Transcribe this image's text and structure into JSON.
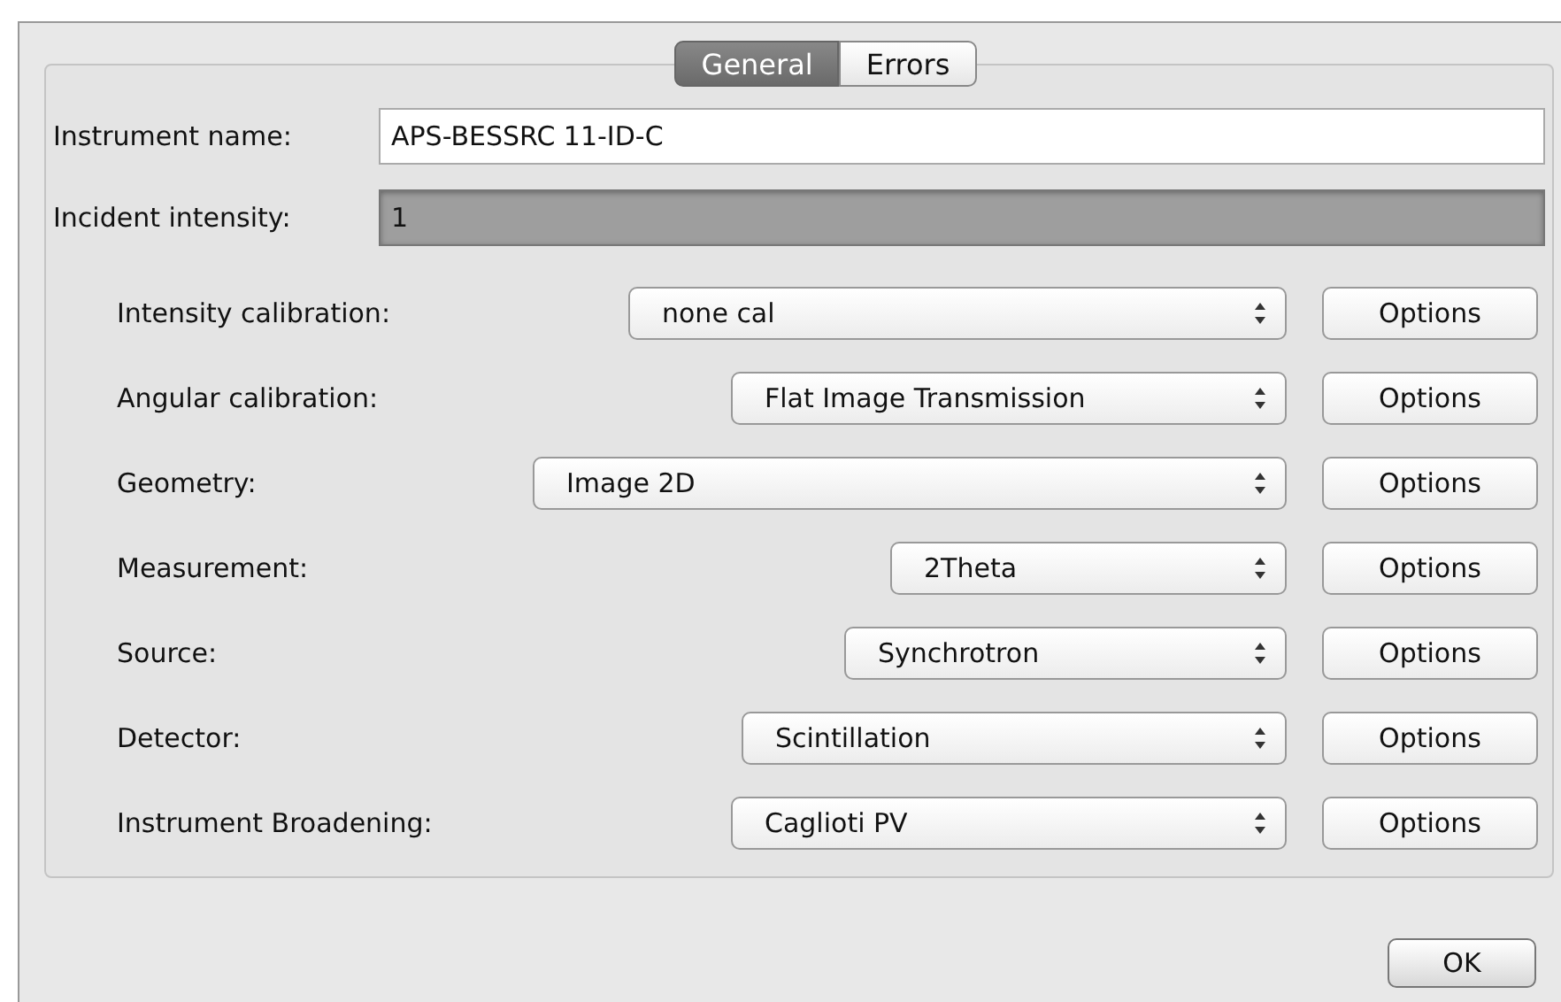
{
  "tabs": [
    {
      "label": "General",
      "selected": true
    },
    {
      "label": "Errors",
      "selected": false
    }
  ],
  "fields": [
    {
      "label": "Instrument name:",
      "value": "APS-BESSRC 11-ID-C",
      "disabled": false
    },
    {
      "label": "Incident intensity:",
      "value": "1",
      "disabled": true
    }
  ],
  "settings": [
    {
      "label": "Intensity calibration:",
      "choice": "none cal",
      "button": "Options"
    },
    {
      "label": "Angular calibration:",
      "choice": "Flat Image Transmission",
      "button": "Options"
    },
    {
      "label": "Geometry:",
      "choice": "Image 2D",
      "button": "Options"
    },
    {
      "label": "Measurement:",
      "choice": "2Theta",
      "button": "Options"
    },
    {
      "label": "Source:",
      "choice": "Synchrotron",
      "button": "Options"
    },
    {
      "label": "Detector:",
      "choice": "Scintillation",
      "button": "Options"
    },
    {
      "label": "Instrument Broadening:",
      "choice": "Caglioti PV",
      "button": "Options"
    }
  ],
  "ok_button": "OK"
}
